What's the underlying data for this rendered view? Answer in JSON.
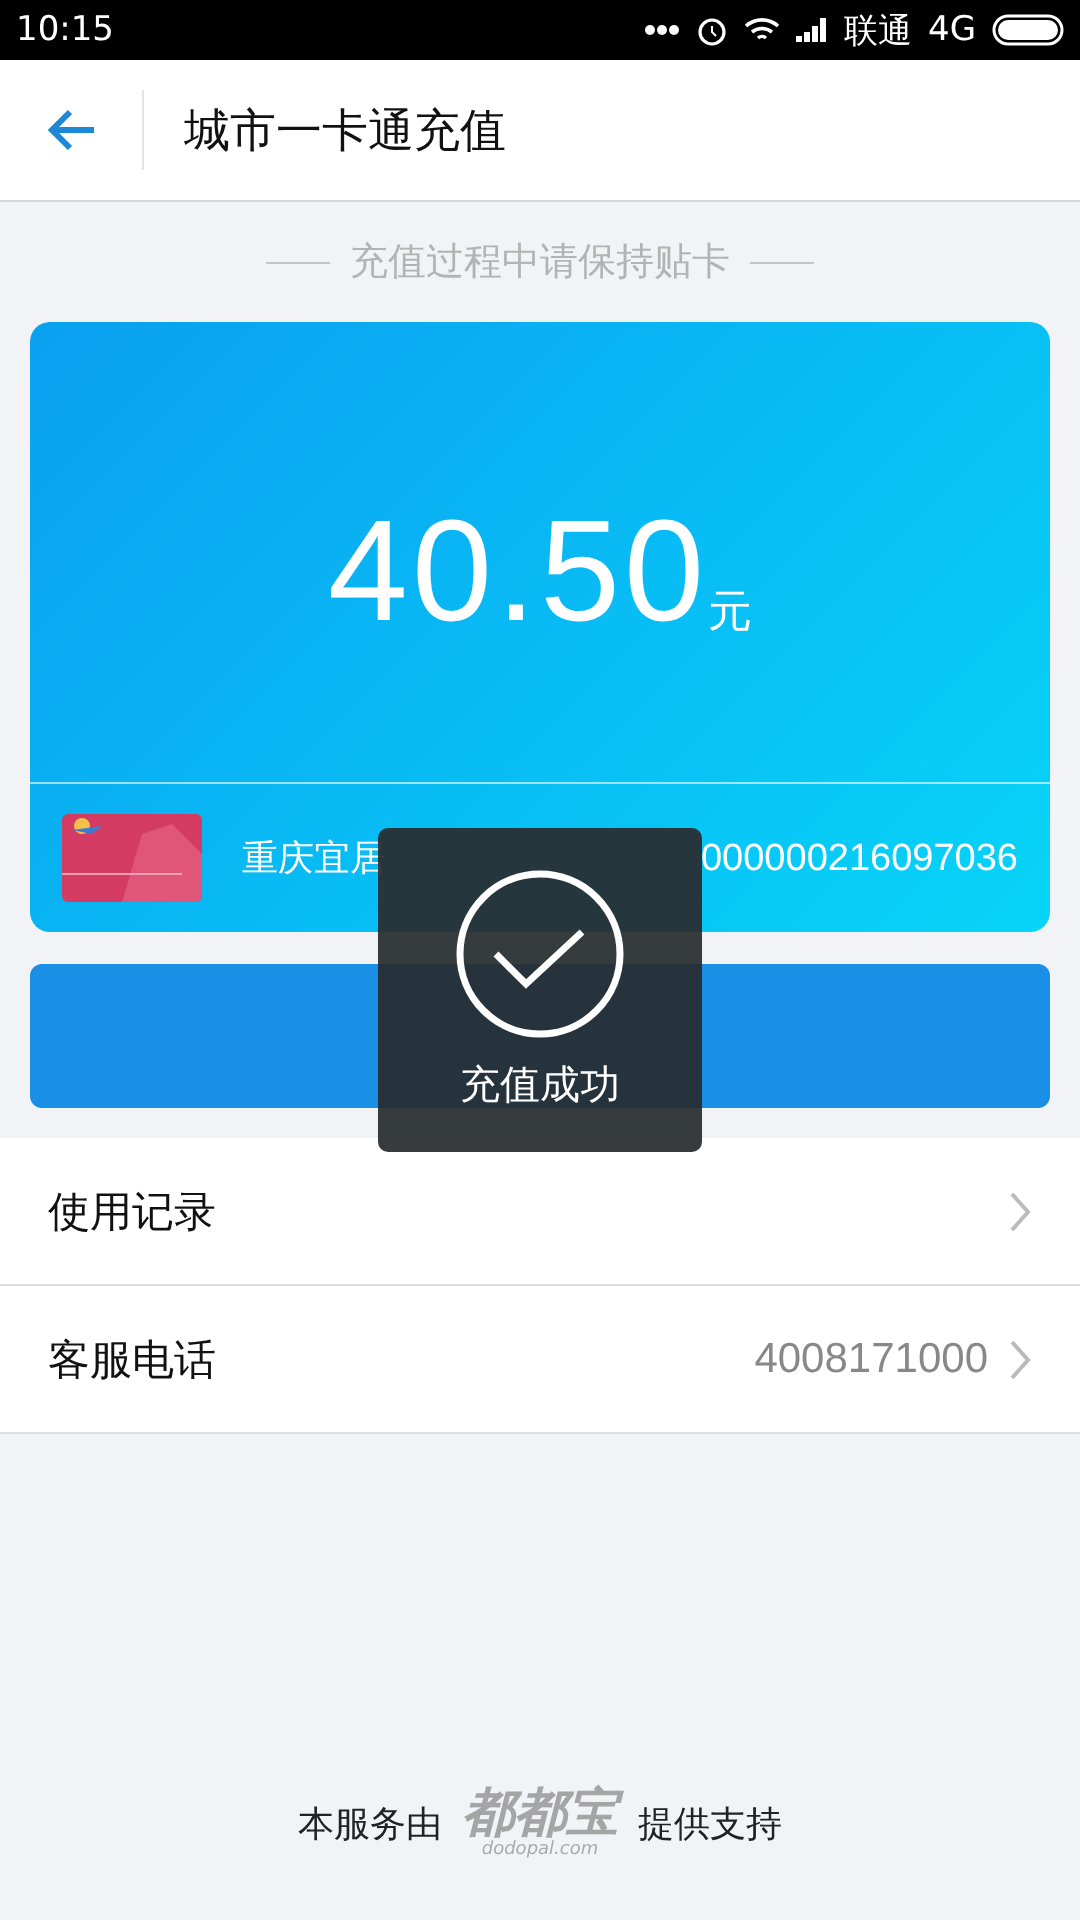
{
  "status_bar": {
    "time": "10:15",
    "carrier": "联通",
    "network": "4G"
  },
  "header": {
    "title": "城市一卡通充值"
  },
  "hint": "充值过程中请保持贴卡",
  "card": {
    "amount": "40.50",
    "unit": "元",
    "name": "重庆宜居",
    "number": "000000216097036"
  },
  "menu": [
    {
      "label": "使用记录"
    },
    {
      "label": "客服电话",
      "value": "4008171000"
    }
  ],
  "footer": {
    "prefix": "本服务由",
    "logo": "都都宝",
    "logo_sub": "dodopal.com",
    "suffix": "提供支持"
  },
  "toast": {
    "message": "充值成功"
  }
}
